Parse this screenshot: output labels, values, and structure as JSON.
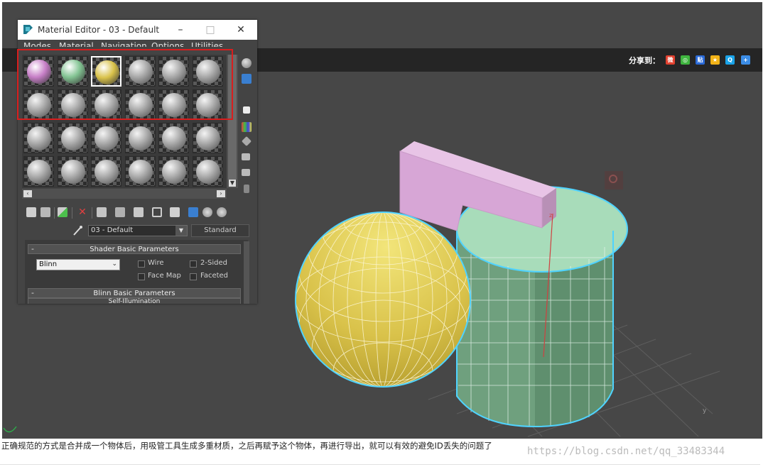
{
  "material_editor": {
    "title": "Material Editor - 03 - Default",
    "menu": [
      "Modes",
      "Material",
      "Navigation",
      "Options",
      "Utilities"
    ],
    "material_name": "03 - Default",
    "material_type": "Standard",
    "shader_rollout": {
      "title": "Shader Basic Parameters",
      "shader": "Blinn",
      "options": [
        "Wire",
        "2-Sided",
        "Face Map",
        "Faceted"
      ]
    },
    "blinn_rollout": {
      "title": "Blinn Basic Parameters",
      "sub": "Self-Illumination"
    },
    "slot_colors": [
      "#c77fc7",
      "#83c493",
      "#d9c24a",
      "gray",
      "gray",
      "gray"
    ]
  },
  "share": {
    "label": "分享到：",
    "icons": [
      "weibo-icon",
      "wechat-icon",
      "baidu-icon",
      "qzone-icon",
      "qq-icon",
      "more-icon"
    ]
  },
  "caption": "正确规范的方式是合并成一个物体后，用吸管工具生成多重材质，之后再赋予这个物体，再进行导出，就可以有效的避免ID丢失的问题了",
  "watermark": "https://blog.csdn.net/qq_33483344",
  "colors": {
    "viewport": "#474747",
    "sphere": "#d9c24a",
    "cylinder": "#a8dcba",
    "box": "#d7a6d6",
    "selection": "#4fd3ff",
    "highlight": "#d81e1e"
  }
}
